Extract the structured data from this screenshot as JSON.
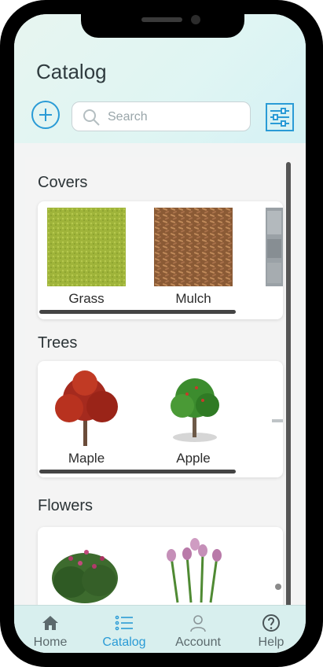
{
  "header": {
    "title": "Catalog"
  },
  "search": {
    "placeholder": "Search"
  },
  "sections": [
    {
      "label": "Covers",
      "items": [
        {
          "label": "Grass"
        },
        {
          "label": "Mulch"
        }
      ]
    },
    {
      "label": "Trees",
      "items": [
        {
          "label": "Maple"
        },
        {
          "label": "Apple"
        }
      ]
    },
    {
      "label": "Flowers",
      "items": []
    }
  ],
  "tabs": [
    {
      "label": "Home",
      "icon": "home-icon"
    },
    {
      "label": "Catalog",
      "icon": "list-icon"
    },
    {
      "label": "Account",
      "icon": "user-icon"
    },
    {
      "label": "Help",
      "icon": "help-icon"
    }
  ],
  "colors": {
    "accent": "#2a9bd6",
    "header_bg": "#e2f5f2",
    "tabbar_bg": "#d8efee"
  }
}
